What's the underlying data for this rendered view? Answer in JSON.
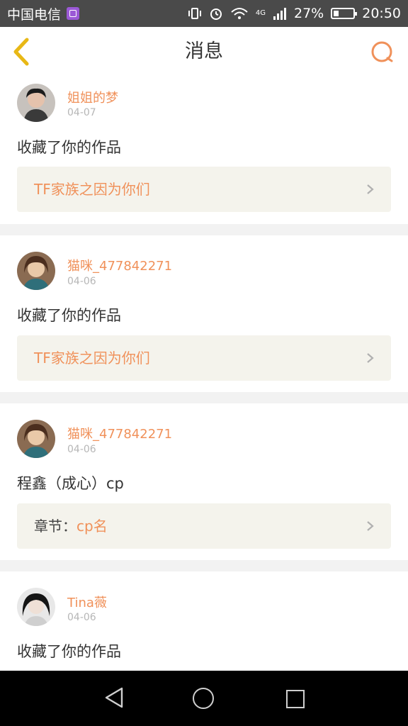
{
  "status_bar": {
    "carrier": "中国电信",
    "battery": "27%",
    "battery_level": 0.27,
    "time": "20:50",
    "icons": [
      "vibrate-icon",
      "alarm-icon",
      "wifi-icon",
      "signal-4g-icon",
      "battery-icon"
    ],
    "network": "4G"
  },
  "header": {
    "title": "消息",
    "back_icon": "chevron-left-icon",
    "search_icon": "search-icon"
  },
  "colors": {
    "accent": "#f0915a",
    "back_icon": "#e8b816",
    "link_background": "#f4f3ec"
  },
  "messages": [
    {
      "user": "姐姐的梦",
      "date": "04-07",
      "text": "收藏了你的作品",
      "link_text": "TF家族之因为你们"
    },
    {
      "user": "猫咪_477842271",
      "date": "04-06",
      "text": "收藏了你的作品",
      "link_text": "TF家族之因为你们"
    },
    {
      "user": "猫咪_477842271",
      "date": "04-06",
      "text": "程鑫（成心）cp",
      "link_prefix": "章节：",
      "link_text": "cp名"
    },
    {
      "user": "Tina薇",
      "date": "04-06",
      "text": "收藏了你的作品"
    }
  ]
}
